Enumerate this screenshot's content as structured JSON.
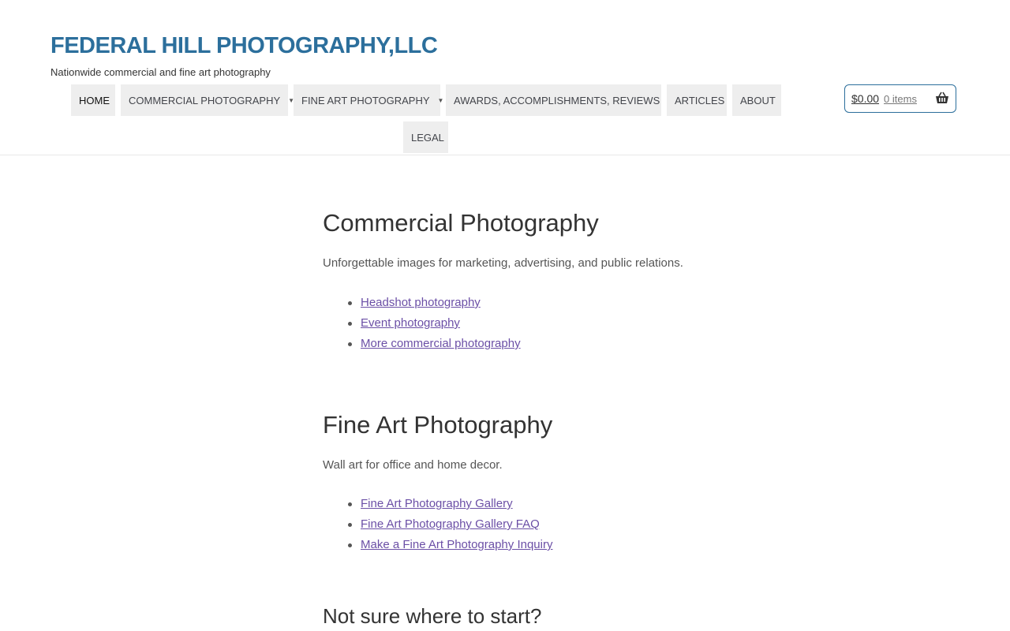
{
  "header": {
    "site_title": "FEDERAL HILL PHOTOGRAPHY,LLC",
    "tagline": "Nationwide commercial and fine art photography"
  },
  "nav": {
    "home": "HOME",
    "commercial": "COMMERCIAL PHOTOGRAPHY",
    "fine_art": "FINE ART PHOTOGRAPHY",
    "awards": "AWARDS, ACCOMPLISHMENTS, REVIEWS",
    "articles": "ARTICLES",
    "about": "ABOUT",
    "legal": "LEGAL"
  },
  "cart": {
    "amount": "$0.00",
    "count": "0 items",
    "icon": "basket-icon"
  },
  "sections": {
    "commercial": {
      "title": "Commercial Photography",
      "description": "Unforgettable images for marketing, advertising, and public relations.",
      "links": [
        "Headshot photography",
        "Event photography",
        "More commercial photography"
      ]
    },
    "fine_art": {
      "title": "Fine Art Photography",
      "description": "Wall art for office and home decor.",
      "links": [
        "Fine Art Photography Gallery",
        "Fine Art Photography Gallery FAQ",
        "Make a Fine Art Photography Inquiry"
      ]
    },
    "start": {
      "title": "Not sure where to start?"
    }
  },
  "colors": {
    "brand": "#2c6f9c",
    "link": "#6b4fa6",
    "nav_bg": "#eeeeee"
  }
}
